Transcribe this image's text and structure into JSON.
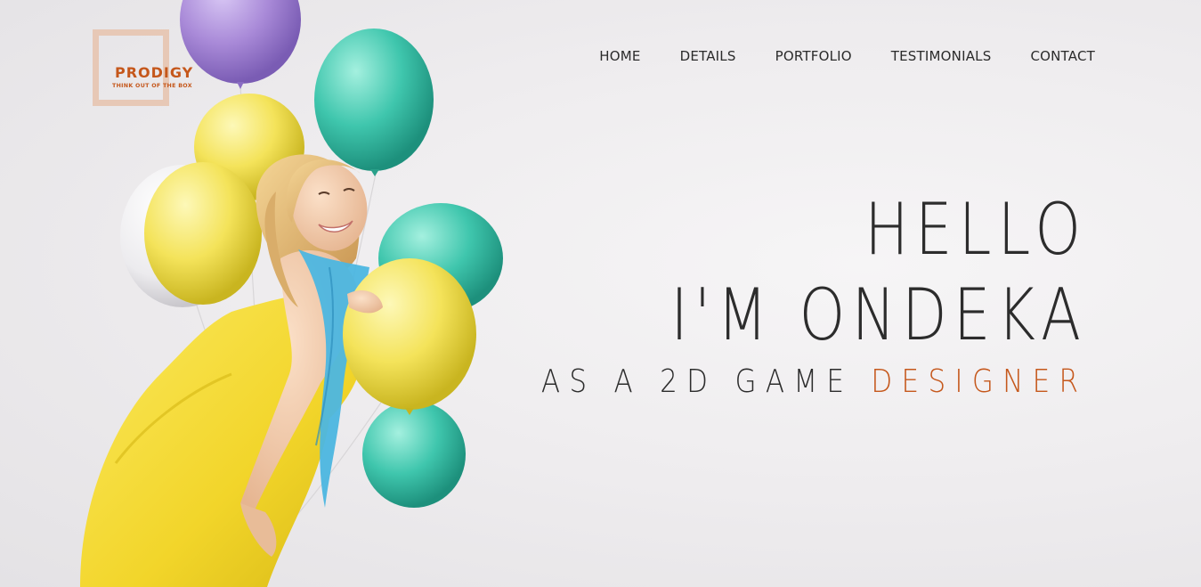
{
  "logo": {
    "name": "PRODIGY",
    "tagline": "THINK OUT OF THE BOX"
  },
  "nav": {
    "items": [
      "HOME",
      "DETAILS",
      "PORTFOLIO",
      "TESTIMONIALS",
      "CONTACT"
    ]
  },
  "hero": {
    "line1": "HELLO",
    "line2": "I'M ONDEKA",
    "sub_prefix": "AS A 2D GAME",
    "sub_accent": "DESIGNER"
  },
  "colors": {
    "accent": "#c5571b",
    "text": "#2c2c2c",
    "logo_box": "#e6c2ad",
    "balloon_purple": "#a98ad8",
    "balloon_teal": "#3fc6ad",
    "balloon_yellow": "#f4e35a",
    "dress_yellow": "#f6de3c",
    "scarf_blue": "#4cb6e0"
  }
}
